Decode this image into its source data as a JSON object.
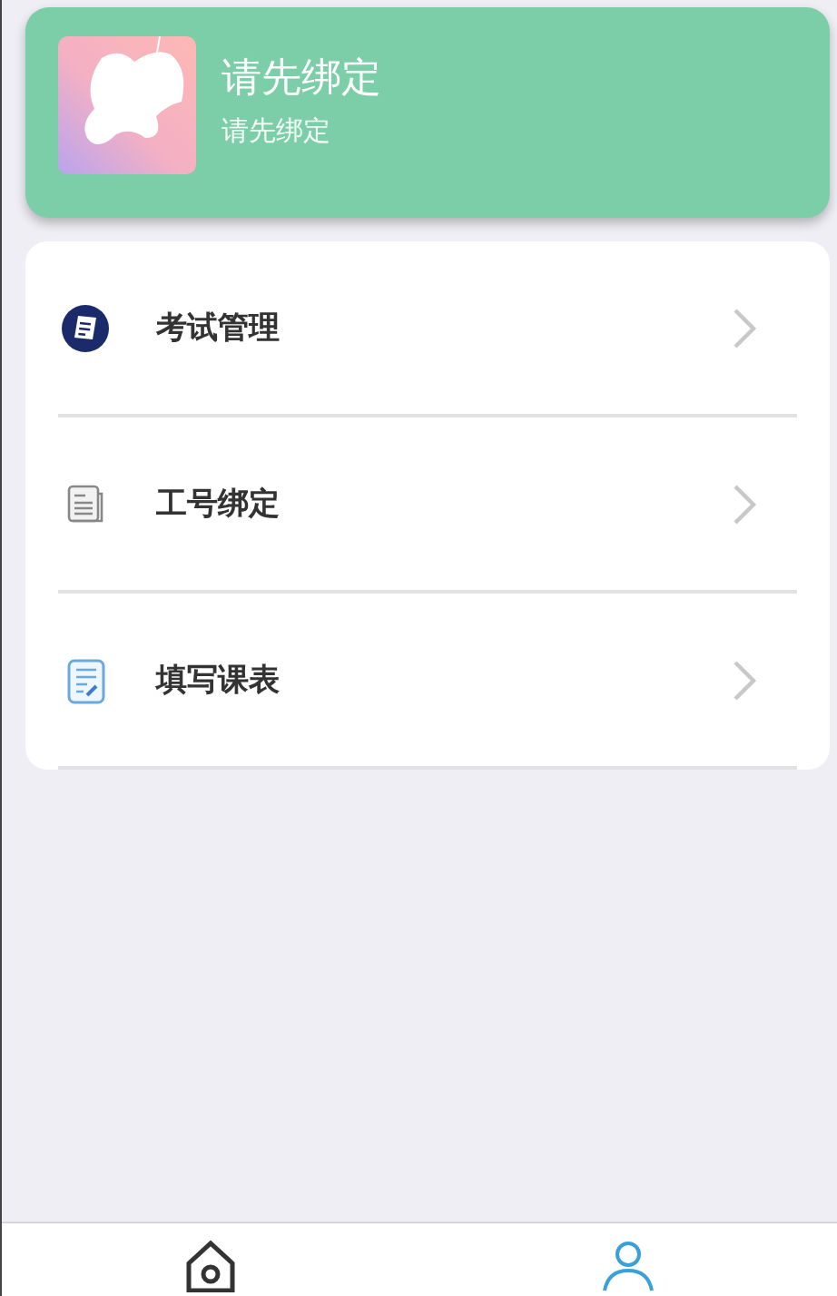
{
  "profile": {
    "title": "请先绑定",
    "subtitle": "请先绑定"
  },
  "menu": [
    {
      "label": "考试管理",
      "kind": "exam"
    },
    {
      "label": "工号绑定",
      "kind": "doc"
    },
    {
      "label": "填写课表",
      "kind": "form"
    }
  ],
  "tab_bar": [
    {
      "kind": "home",
      "selected": false
    },
    {
      "kind": "person",
      "selected": true
    }
  ]
}
